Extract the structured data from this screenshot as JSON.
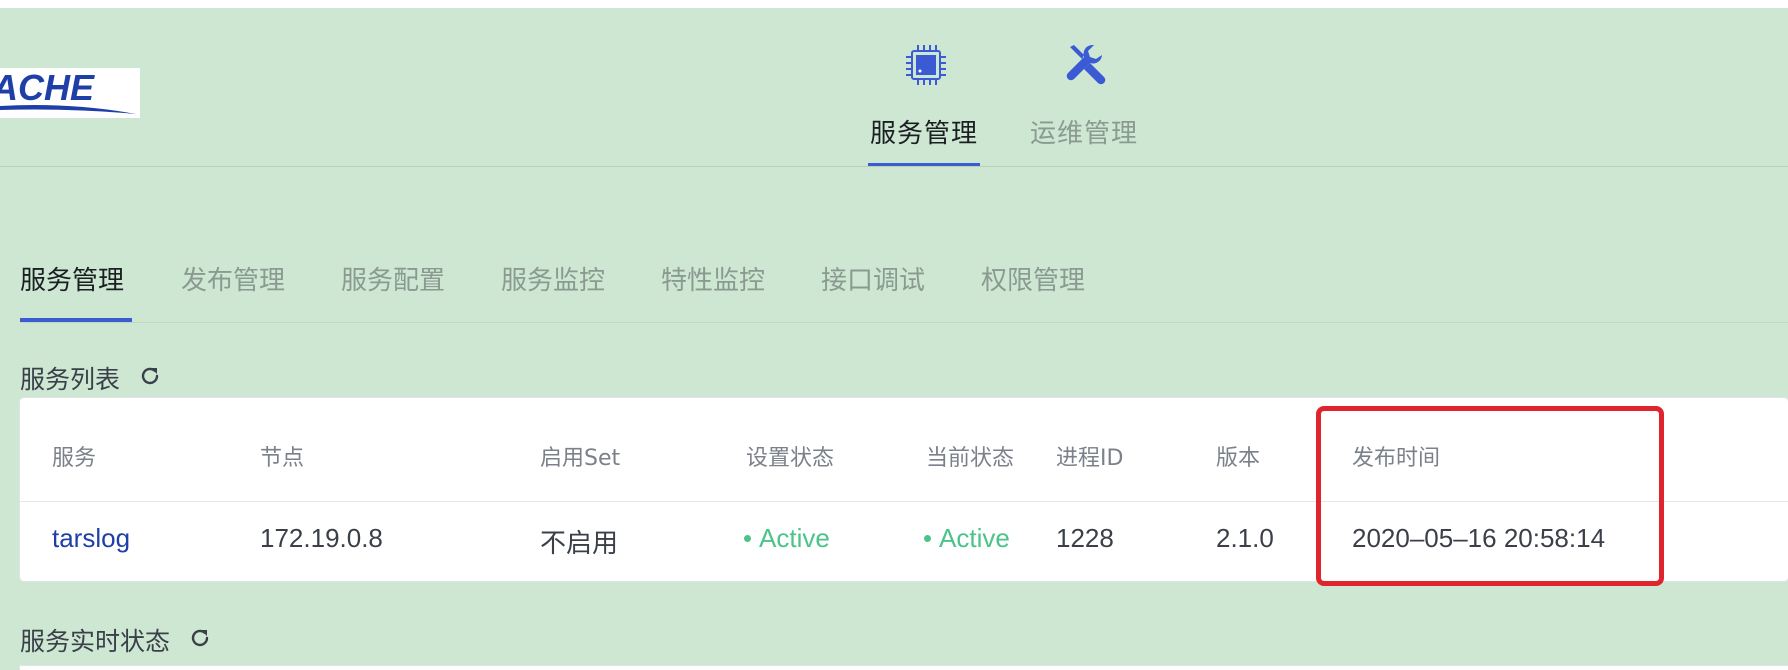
{
  "header": {
    "logo_text": "ACHE",
    "top_tabs": [
      {
        "label": "服务管理",
        "icon": "chip-icon",
        "active": true
      },
      {
        "label": "运维管理",
        "icon": "tools-icon",
        "active": false
      }
    ]
  },
  "sub_nav": {
    "tabs": [
      {
        "label": "服务管理",
        "active": true
      },
      {
        "label": "发布管理",
        "active": false
      },
      {
        "label": "服务配置",
        "active": false
      },
      {
        "label": "服务监控",
        "active": false
      },
      {
        "label": "特性监控",
        "active": false
      },
      {
        "label": "接口调试",
        "active": false
      },
      {
        "label": "权限管理",
        "active": false
      }
    ]
  },
  "service_list": {
    "title": "服务列表",
    "refresh_icon": "refresh-icon",
    "columns": [
      "服务",
      "节点",
      "启用Set",
      "设置状态",
      "当前状态",
      "进程ID",
      "版本",
      "发布时间"
    ],
    "rows": [
      {
        "service": "tarslog",
        "node": "172.19.0.8",
        "set_enabled": "不启用",
        "setting_state": "Active",
        "current_state": "Active",
        "pid": "1228",
        "version": "2.1.0",
        "publish_time": "2020–05–16 20:58:14"
      }
    ]
  },
  "realtime_status": {
    "title": "服务实时状态",
    "refresh_icon": "refresh-icon"
  },
  "colors": {
    "page_background": "#cee7d2",
    "accent": "#3a5bd4",
    "active_status": "#4bc48a",
    "link": "#1f3fa8",
    "highlight": "#e0242e"
  }
}
